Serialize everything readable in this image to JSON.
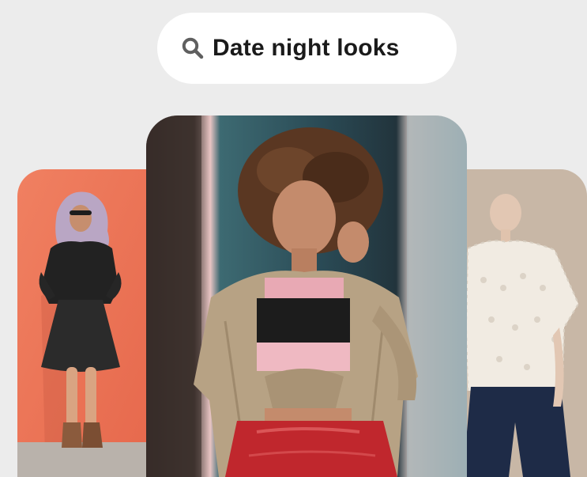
{
  "search": {
    "query": "Date night looks",
    "icon": "search-icon"
  },
  "pins": [
    {
      "name": "pin-left",
      "accent": "#f0785a"
    },
    {
      "name": "pin-center",
      "accent": "#c9463c"
    },
    {
      "name": "pin-right",
      "accent": "#c9b7a6"
    }
  ],
  "colors": {
    "background": "#ececec",
    "search_bg": "#ffffff",
    "text": "#1a1a1a"
  }
}
